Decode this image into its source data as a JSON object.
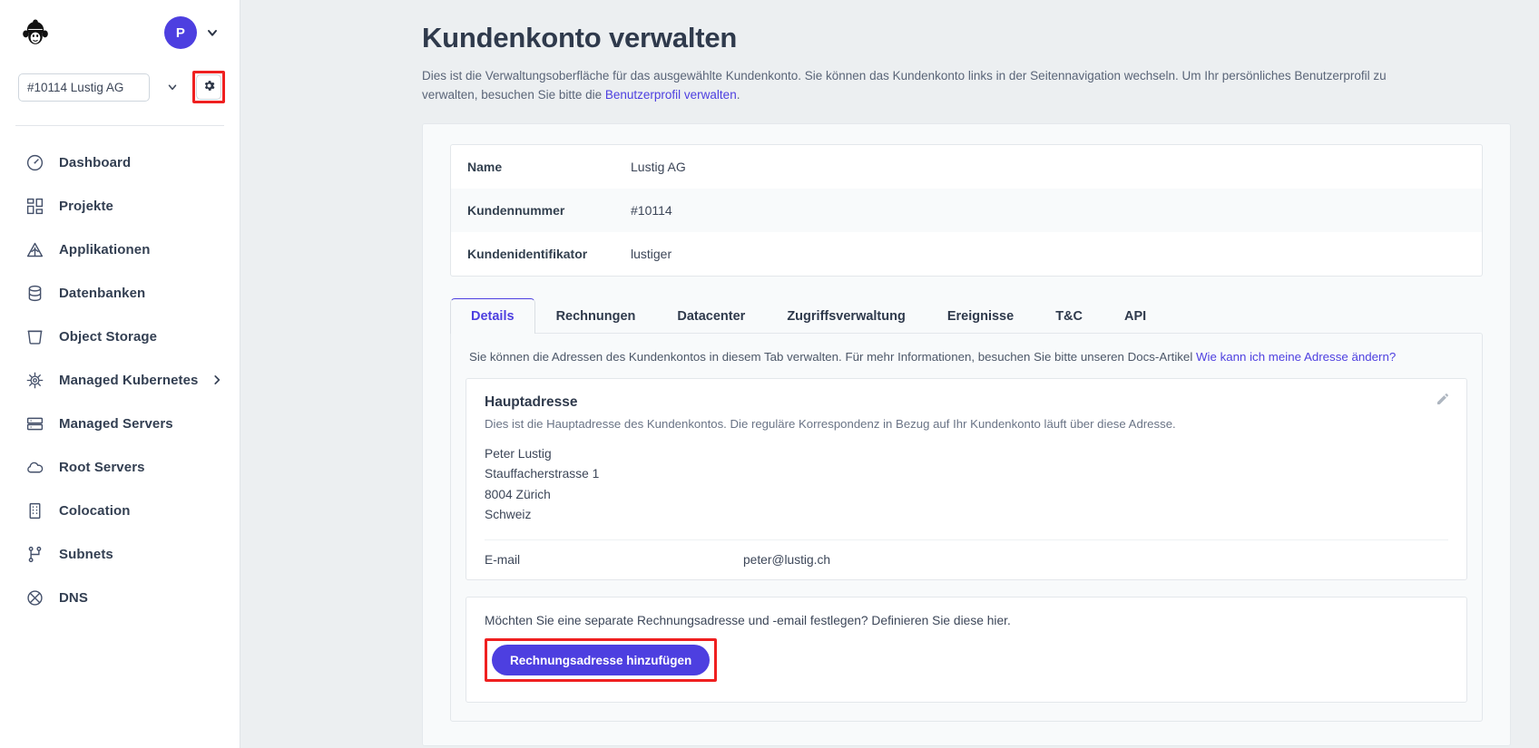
{
  "sidebar": {
    "logo_icon": "monkey-pilot-logo",
    "avatar_initial": "P",
    "customer_select_value": "#10114 Lustig AG",
    "customer_select_options": [
      "#10114 Lustig AG"
    ],
    "gear_icon": "gear-icon",
    "nav_items": [
      {
        "label": "Dashboard",
        "icon": "dashboard-gauge-icon",
        "has_arrow": false
      },
      {
        "label": "Projekte",
        "icon": "projects-grid-icon",
        "has_arrow": false
      },
      {
        "label": "Applikationen",
        "icon": "applications-icon",
        "has_arrow": false
      },
      {
        "label": "Datenbanken",
        "icon": "database-icon",
        "has_arrow": false
      },
      {
        "label": "Object Storage",
        "icon": "bucket-icon",
        "has_arrow": false
      },
      {
        "label": "Managed Kubernetes",
        "icon": "kubernetes-helm-icon",
        "has_arrow": true
      },
      {
        "label": "Managed Servers",
        "icon": "server-rack-icon",
        "has_arrow": false
      },
      {
        "label": "Root Servers",
        "icon": "cloud-icon",
        "has_arrow": false
      },
      {
        "label": "Colocation",
        "icon": "building-icon",
        "has_arrow": false
      },
      {
        "label": "Subnets",
        "icon": "network-nodes-icon",
        "has_arrow": false
      },
      {
        "label": "DNS",
        "icon": "dns-globe-icon",
        "has_arrow": false
      }
    ]
  },
  "page": {
    "title": "Kundenkonto verwalten",
    "desc_part1": "Dies ist die Verwaltungsoberfläche für das ausgewählte Kundenkonto. Sie können das Kundenkonto links in der Seitennavigation wechseln. Um Ihr persönliches Benutzerprofil zu verwalten, besuchen Sie bitte die ",
    "desc_link": "Benutzerprofil verwalten",
    "desc_part2": "."
  },
  "info_table": {
    "rows": [
      {
        "key": "Name",
        "value": "Lustig AG"
      },
      {
        "key": "Kundennummer",
        "value": "#10114"
      },
      {
        "key": "Kundenidentifikator",
        "value": "lustiger"
      }
    ]
  },
  "tabs": [
    {
      "label": "Details",
      "active": true
    },
    {
      "label": "Rechnungen",
      "active": false
    },
    {
      "label": "Datacenter",
      "active": false
    },
    {
      "label": "Zugriffsverwaltung",
      "active": false
    },
    {
      "label": "Ereignisse",
      "active": false
    },
    {
      "label": "T&C",
      "active": false
    },
    {
      "label": "API",
      "active": false
    }
  ],
  "details_panel": {
    "hint_part1": "Sie können die Adressen des Kundenkontos in diesem Tab verwalten. Für mehr Informationen, besuchen Sie bitte unseren Docs-Artikel ",
    "hint_link": "Wie kann ich meine Adresse ändern?",
    "main_address": {
      "title": "Hauptadresse",
      "subtitle": "Dies ist die Hauptadresse des Kundenkontos. Die reguläre Korrespondenz in Bezug auf Ihr Kundenkonto läuft über diese Adresse.",
      "line1": "Peter Lustig",
      "line2": "Stauffacherstrasse 1",
      "line3": "8004 Zürich",
      "line4": "Schweiz",
      "email_label": "E-mail",
      "email_value": "peter@lustig.ch",
      "edit_icon": "pencil-edit-icon"
    },
    "billing": {
      "text": "Möchten Sie eine separate Rechnungsadresse und -email festlegen? Definieren Sie diese hier.",
      "button_label": "Rechnungsadresse hinzufügen"
    }
  },
  "colors": {
    "accent": "#4d3fe0",
    "highlight_box": "#ef2020",
    "page_bg": "#eceff1",
    "text_dark": "#2f3a4c"
  }
}
